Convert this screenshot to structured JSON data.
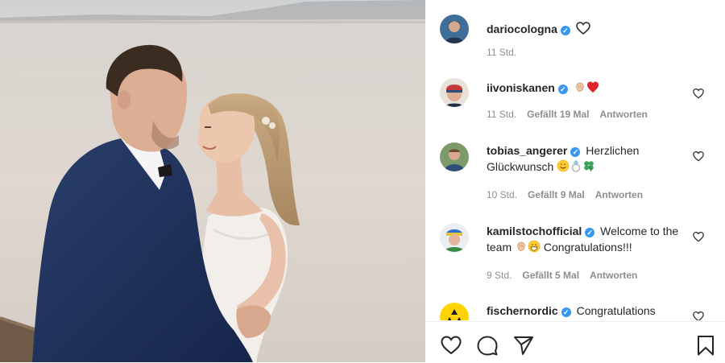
{
  "post": {
    "author": "dariocologna",
    "time": "11 Std."
  },
  "comments": [
    {
      "user": "iivoniskanen",
      "verified": true,
      "text": "",
      "emojis": [
        "clapping-hands",
        "red-heart"
      ],
      "time": "11 Std.",
      "likes": "Gefällt 19 Mal",
      "reply": "Antworten"
    },
    {
      "user": "tobias_angerer",
      "verified": true,
      "text": "Herzlichen Glückwunsch",
      "emojis": [
        "smiling-face",
        "ring",
        "four-leaf-clover"
      ],
      "time": "10 Std.",
      "likes": "Gefällt 9 Mal",
      "reply": "Antworten"
    },
    {
      "user": "kamilstochofficial",
      "verified": true,
      "text": "Welcome to the team",
      "text_after": "Congratulations!!!",
      "emojis": [
        "clapping-hands",
        "grinning-face"
      ],
      "time": "9 Std.",
      "likes": "Gefällt 5 Mal",
      "reply": "Antworten"
    },
    {
      "user": "fischernordic",
      "verified": true,
      "text": "Congratulations"
    }
  ],
  "icons": {
    "like": "heart-icon",
    "comment": "comment-icon",
    "share": "send-icon",
    "save": "bookmark-icon"
  },
  "colors": {
    "verified": "#3897f0",
    "meta_text": "#8e8e8e",
    "heart": "#ed4956"
  }
}
